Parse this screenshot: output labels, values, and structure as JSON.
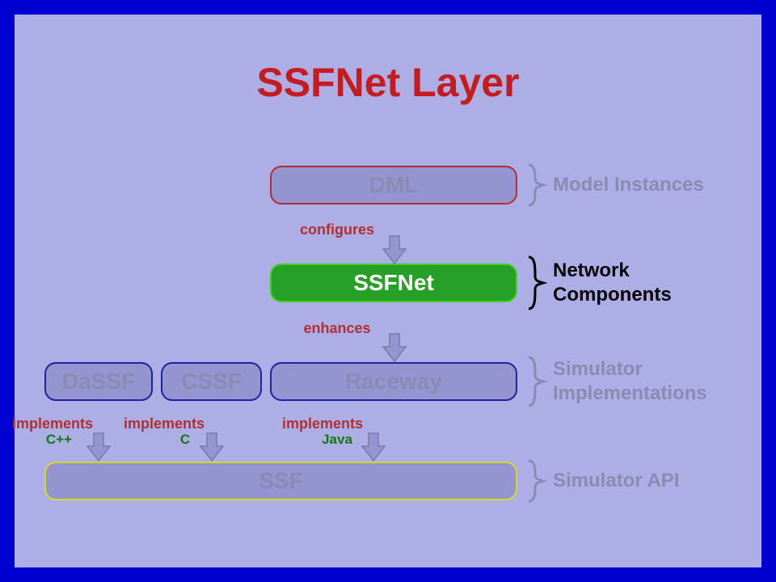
{
  "title": "SSFNet Layer",
  "boxes": {
    "dml": "DML",
    "ssfnet": "SSFNet",
    "raceway": "Raceway",
    "cssf": "CSSF",
    "dassf": "DaSSF",
    "ssf": "SSF"
  },
  "edges": {
    "configures": "configures",
    "enhances": "enhances",
    "impl1": "implements",
    "impl2": "implements",
    "impl3": "implements"
  },
  "langs": {
    "dassf": "C++",
    "cssf": "C",
    "raceway": "Java"
  },
  "layers": {
    "model_instances": "Model Instances",
    "network_components": "Network\nComponents",
    "simulator_implementations": "Simulator\nImplementations",
    "simulator_api": "Simulator API"
  },
  "chart_data": {
    "type": "table",
    "title": "SSFNet Layer",
    "layers": [
      {
        "level": 1,
        "label": "Model Instances",
        "components": [
          "DML"
        ]
      },
      {
        "level": 2,
        "label": "Network Components",
        "components": [
          "SSFNet"
        ]
      },
      {
        "level": 3,
        "label": "Simulator Implementations",
        "components": [
          "DaSSF",
          "CSSF",
          "Raceway"
        ]
      },
      {
        "level": 4,
        "label": "Simulator API",
        "components": [
          "SSF"
        ]
      }
    ],
    "edges": [
      {
        "from": "DML",
        "to": "SSFNet",
        "relation": "configures"
      },
      {
        "from": "SSFNet",
        "to": "Raceway",
        "relation": "enhances"
      },
      {
        "from": "DaSSF",
        "to": "SSF",
        "relation": "implements",
        "language": "C++"
      },
      {
        "from": "CSSF",
        "to": "SSF",
        "relation": "implements",
        "language": "C"
      },
      {
        "from": "Raceway",
        "to": "SSF",
        "relation": "implements",
        "language": "Java"
      }
    ]
  }
}
